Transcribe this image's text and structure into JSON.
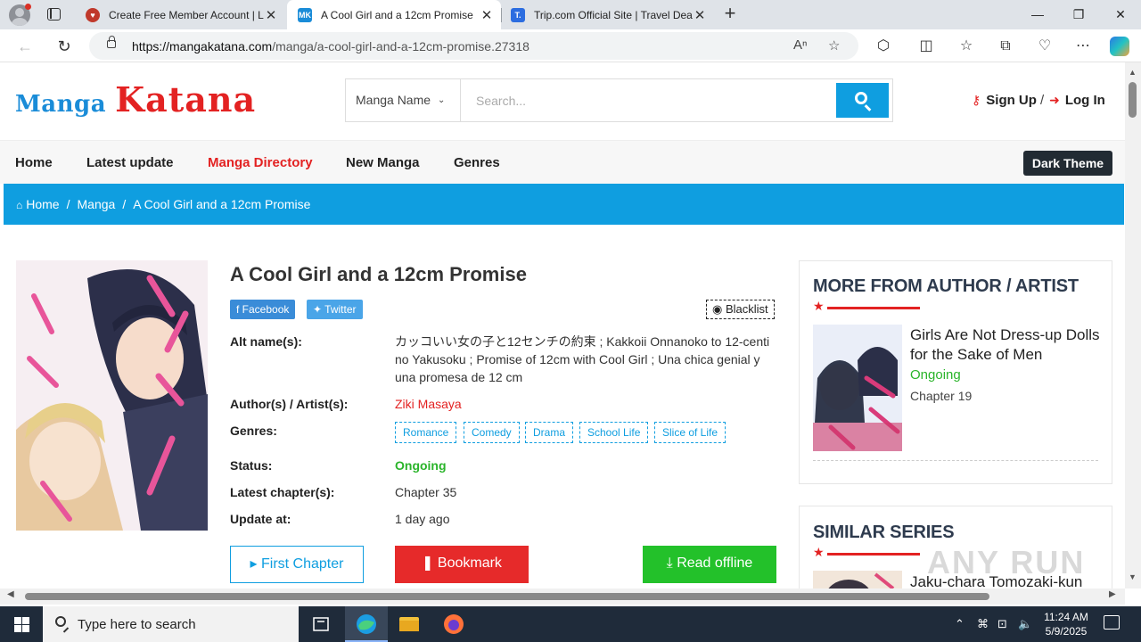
{
  "browser": {
    "tabs": [
      {
        "title": "Create Free Member Account | Lit",
        "favicon": "heart-shield-icon"
      },
      {
        "title": "A Cool Girl and a 12cm Promise",
        "favicon": "mk-icon"
      },
      {
        "title": "Trip.com Official Site | Travel Deal",
        "favicon": "trip-icon"
      }
    ],
    "url_domain": "https://mangakatana.com",
    "url_path": "/manga/a-cool-girl-and-a-12cm-promise.27318"
  },
  "site": {
    "logo_part1": "Manga",
    "logo_part2": "Katana",
    "search": {
      "category": "Manga Name",
      "placeholder": "Search..."
    },
    "auth": {
      "signup": "Sign Up",
      "login": "Log In"
    },
    "nav": [
      "Home",
      "Latest update",
      "Manga Directory",
      "New Manga",
      "Genres"
    ],
    "nav_current": "Manga Directory",
    "dark_theme": "Dark Theme",
    "breadcrumb": [
      "Home",
      "Manga",
      "A Cool Girl and a 12cm Promise"
    ]
  },
  "manga": {
    "title": "A Cool Girl and a 12cm Promise",
    "share_facebook": "Facebook",
    "share_twitter": "Twitter",
    "blacklist": "Blacklist",
    "labels": {
      "alt": "Alt name(s):",
      "authors": "Author(s) / Artist(s):",
      "genres": "Genres:",
      "status": "Status:",
      "latest": "Latest chapter(s):",
      "update": "Update at:"
    },
    "alt_names": "カッコいい女の子と12センチの約束 ; Kakkoii Onnanoko to 12-centi no Yakusoku ; Promise of 12cm with Cool Girl ; Una chica genial y una promesa de 12 cm",
    "author": "Ziki Masaya",
    "genres": [
      "Romance",
      "Comedy",
      "Drama",
      "School Life",
      "Slice of Life"
    ],
    "status": "Ongoing",
    "latest_chapter": "Chapter 35",
    "update_at": "1 day ago",
    "buttons": {
      "first": "First Chapter",
      "bookmark": "Bookmark",
      "offline": "Read offline"
    }
  },
  "sidebar": {
    "more_title": "MORE FROM AUTHOR / ARTIST",
    "more_item": {
      "title": "Girls Are Not Dress-up Dolls for the Sake of Men",
      "status": "Ongoing",
      "chapter": "Chapter 19"
    },
    "similar_title": "SIMILAR SERIES",
    "similar_item": {
      "title": "Jaku-chara Tomozaki-kun"
    }
  },
  "watermark": "ANY RUN",
  "taskbar": {
    "search_placeholder": "Type here to search",
    "time": "11:24 AM",
    "date": "5/9/2025"
  },
  "colors": {
    "brand_red": "#e32222",
    "brand_blue": "#0f9ee0",
    "status_green": "#2ab42a"
  }
}
